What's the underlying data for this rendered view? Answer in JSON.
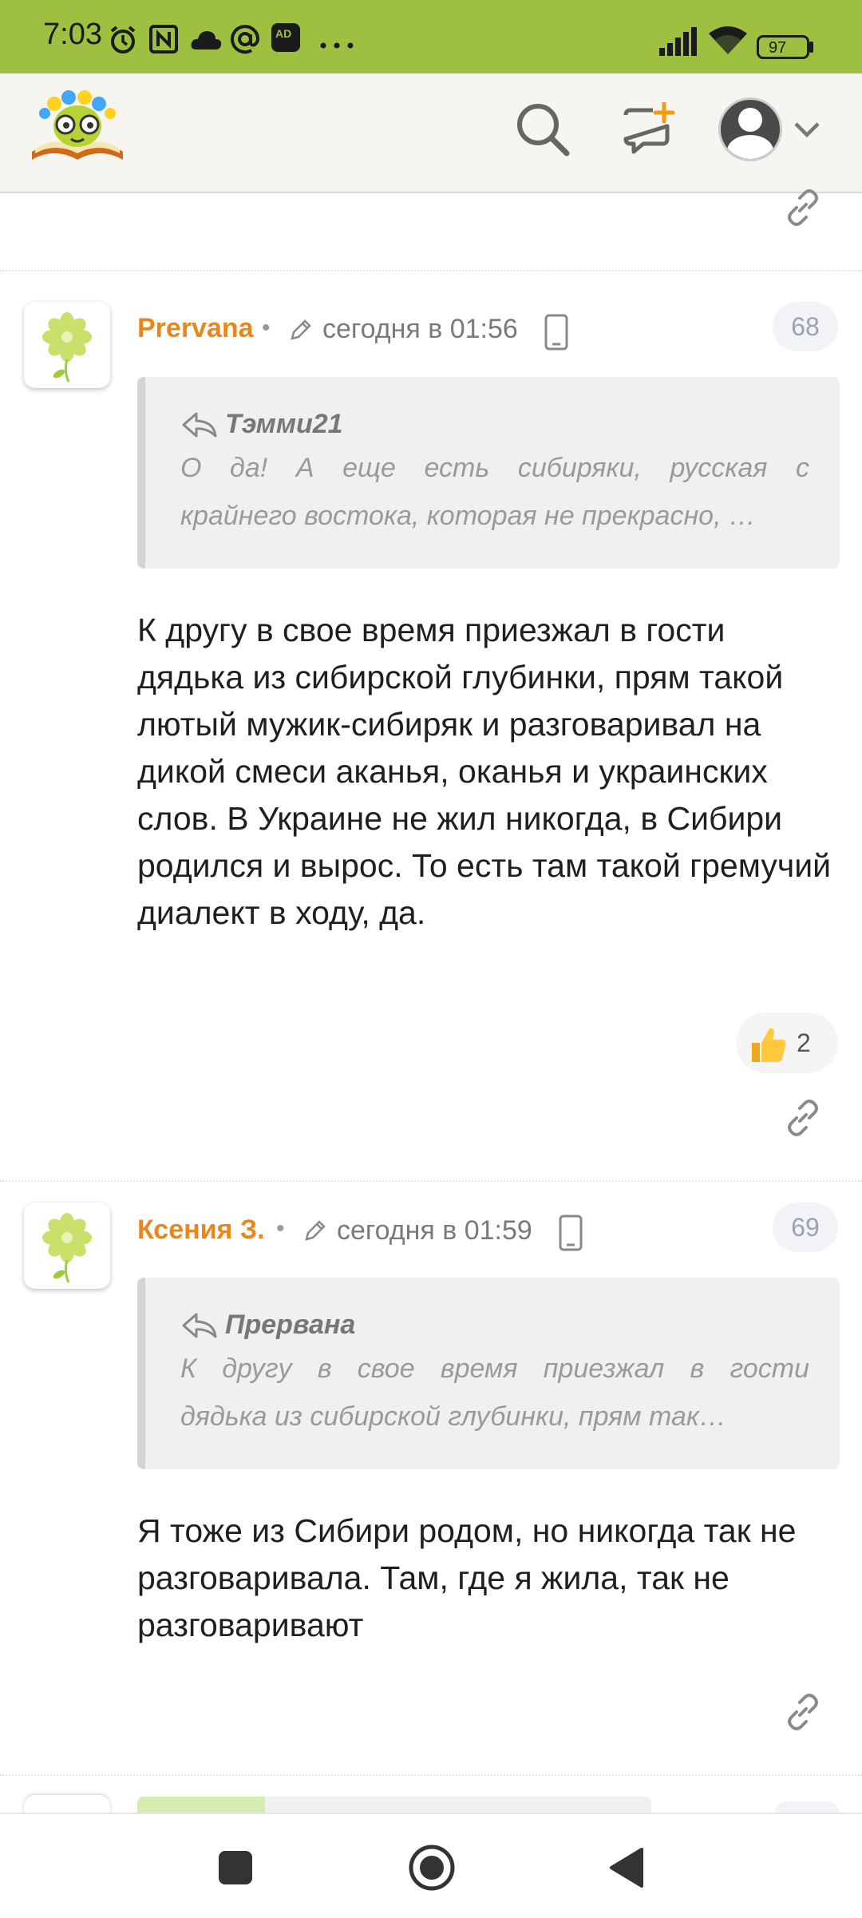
{
  "status_bar": {
    "time": "7:03",
    "battery": "97",
    "notification_icons": [
      "alarm-icon",
      "nfc-icon",
      "cloud-icon",
      "at-icon",
      "adblock-icon",
      "more-icon"
    ],
    "adblock_text": "AD"
  },
  "header": {
    "icons": [
      "logo-icon",
      "search-icon",
      "new-message-icon",
      "avatar-icon",
      "chevron-down-icon"
    ]
  },
  "comments": [
    {
      "author": "Prervana",
      "time": "сегодня в 01:56",
      "number": "68",
      "quote_author": "Тэмми21",
      "quote_lines": [
        "О да! А еще есть сибиряки, русская с",
        "крайнего востока, которая не прекрасно, …"
      ],
      "body": "К другу в свое время приезжал в гости дядька из сибирской глубинки, прям такой лютый мужик-сибиряк и разговаривал на дикой смеси аканья, оканья и украинских слов. В Украине не жил никогда, в Сибири родился и вырос. То есть там такой гремучий диалект в ходу, да.",
      "likes": "2"
    },
    {
      "author": "Ксения З.",
      "time": "сегодня в 01:59",
      "number": "69",
      "quote_author": "Прервана",
      "quote_lines": [
        "К другу в свое время приезжал в гости",
        "дядька из сибирской глубинки, прям так…"
      ],
      "body": "Я тоже из Сибири родом, но никогда так не разговаривала. Там, где я жила, так не разговаривают"
    }
  ],
  "colors": {
    "status_bar": "#9dc041",
    "author": "#e8871e",
    "header_bg": "#f7f5f0"
  }
}
